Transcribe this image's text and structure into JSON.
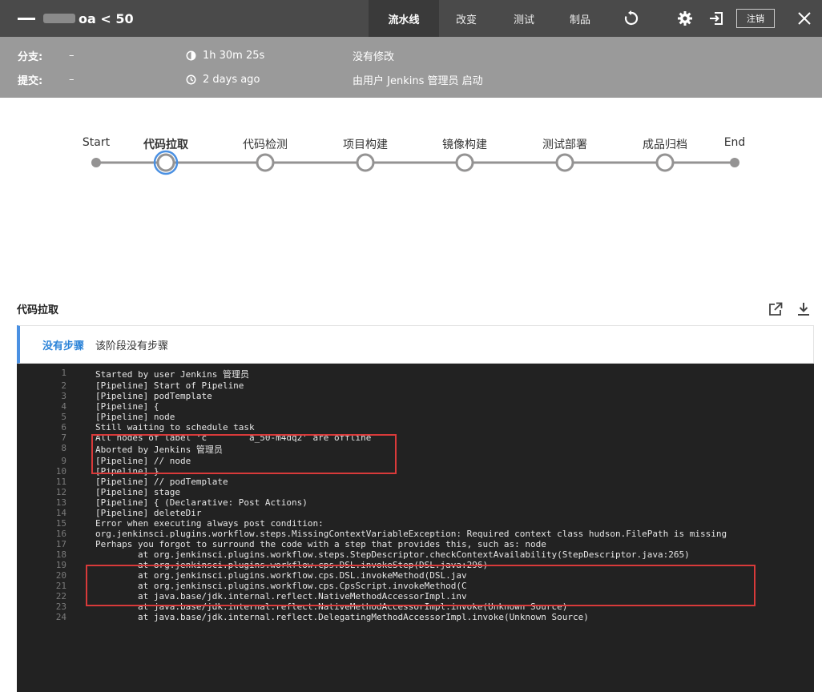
{
  "header": {
    "title_suffix": "oa < 50",
    "tabs": [
      {
        "label": "流水线",
        "active": true
      },
      {
        "label": "改变",
        "active": false
      },
      {
        "label": "测试",
        "active": false
      },
      {
        "label": "制品",
        "active": false
      }
    ],
    "logout_label": "注销"
  },
  "info": {
    "branch_label": "分支:",
    "branch_value": "–",
    "commit_label": "提交:",
    "commit_value": "–",
    "duration": "1h 30m 25s",
    "time_ago": "2 days ago",
    "changes": "没有修改",
    "started_by": "由用户 Jenkins 管理员 启动"
  },
  "pipeline": {
    "stages": [
      {
        "label": "Start",
        "kind": "endpoint",
        "active": false
      },
      {
        "label": "代码拉取",
        "kind": "stage",
        "active": true
      },
      {
        "label": "代码检测",
        "kind": "stage",
        "active": false
      },
      {
        "label": "项目构建",
        "kind": "stage",
        "active": false
      },
      {
        "label": "镜像构建",
        "kind": "stage",
        "active": false
      },
      {
        "label": "测试部署",
        "kind": "stage",
        "active": false
      },
      {
        "label": "成品归档",
        "kind": "stage",
        "active": false
      },
      {
        "label": "End",
        "kind": "endpoint",
        "active": false
      }
    ]
  },
  "section": {
    "title": "代码拉取",
    "steps_tag": "没有步骤",
    "steps_desc": "该阶段没有步骤"
  },
  "colors": {
    "accent": "#4a90e2",
    "highlight": "#d93a3a",
    "console_bg": "#222222"
  },
  "log": [
    {
      "n": "1",
      "text": "Started by user Jenkins 管理员"
    },
    {
      "n": "2",
      "text": "[Pipeline] Start of Pipeline"
    },
    {
      "n": "3",
      "text": "[Pipeline] podTemplate"
    },
    {
      "n": "4",
      "text": "[Pipeline] {"
    },
    {
      "n": "5",
      "text": "[Pipeline] node"
    },
    {
      "n": "6",
      "text": "Still waiting to schedule task"
    },
    {
      "n": "7",
      "text": "All nodes of label ‘c        a_50-m4dq2’ are offline"
    },
    {
      "n": "8",
      "text": "Aborted by Jenkins 管理员"
    },
    {
      "n": "9",
      "text": "[Pipeline] // node"
    },
    {
      "n": "10",
      "text": "[Pipeline] }"
    },
    {
      "n": "11",
      "text": "[Pipeline] // podTemplate"
    },
    {
      "n": "12",
      "text": "[Pipeline] stage"
    },
    {
      "n": "13",
      "text": "[Pipeline] { (Declarative: Post Actions)"
    },
    {
      "n": "14",
      "text": "[Pipeline] deleteDir"
    },
    {
      "n": "15",
      "text": "Error when executing always post condition:"
    },
    {
      "n": "16",
      "text": "org.jenkinsci.plugins.workflow.steps.MissingContextVariableException: Required context class hudson.FilePath is missing"
    },
    {
      "n": "17",
      "text": "Perhaps you forgot to surround the code with a step that provides this, such as: node"
    },
    {
      "n": "18",
      "text": "        at org.jenkinsci.plugins.workflow.steps.StepDescriptor.checkContextAvailability(StepDescriptor.java:265)"
    },
    {
      "n": "19",
      "text": "        at org.jenkinsci.plugins.workflow.cps.DSL.invokeStep(DSL.java:296)"
    },
    {
      "n": "20",
      "text": "        at org.jenkinsci.plugins.workflow.cps.DSL.invokeMethod(DSL.jav"
    },
    {
      "n": "21",
      "text": "        at org.jenkinsci.plugins.workflow.cps.CpsScript.invokeMethod(C"
    },
    {
      "n": "22",
      "text": "        at java.base/jdk.internal.reflect.NativeMethodAccessorImpl.inv"
    },
    {
      "n": "23",
      "text": "        at java.base/jdk.internal.reflect.NativeMethodAccessorImpl.invoke(Unknown Source)"
    },
    {
      "n": "24",
      "text": "        at java.base/jdk.internal.reflect.DelegatingMethodAccessorImpl.invoke(Unknown Source)"
    }
  ]
}
